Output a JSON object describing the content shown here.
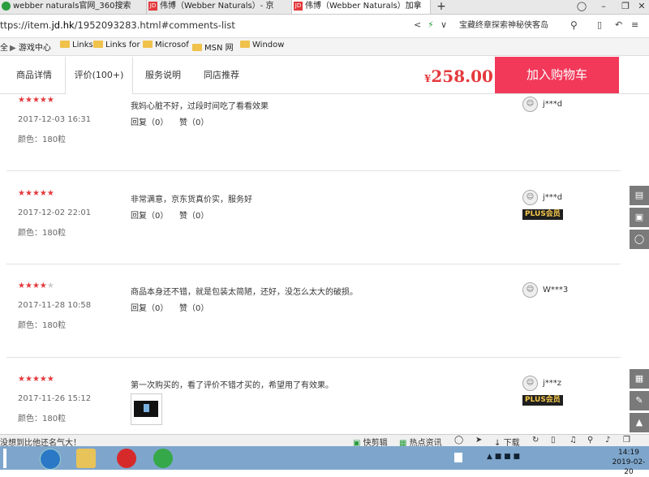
{
  "browser": {
    "tabs": [
      {
        "title": "webber naturals官网_360搜索",
        "icon": "search-favicon",
        "color": "#2a9d3f"
      },
      {
        "title": "伟博（Webber Naturals）- 京",
        "icon": "jd-favicon",
        "color": "#e4393c"
      },
      {
        "title": "伟博（Webber Naturals）加拿",
        "icon": "jd-favicon",
        "color": "#e4393c"
      }
    ],
    "new_tab": "+",
    "url_prefix": "ttps://item.",
    "url_domain": "jd.hk",
    "url_rest": "/1952093283.html#comments-list",
    "search_text": "宝藏终章探索神秘侠客岛",
    "bookmarks": [
      "全",
      "游戏中心",
      "Links",
      "Links for",
      "Microsof",
      "MSN 网",
      "Window"
    ]
  },
  "product_nav": {
    "tabs": [
      "商品详情",
      "评价(100+)",
      "服务说明",
      "同店推荐"
    ],
    "currency": "¥",
    "price": "258.00",
    "cart_button": "加入购物车"
  },
  "comments": [
    {
      "rating": 5,
      "date": "2017-12-03 16:31",
      "attr": "颜色：180粒",
      "text": "我妈心脏不好，过段时间吃了看看效果",
      "reply": "回复（0）",
      "like": "赞（0）",
      "user": "j***d",
      "plus": ""
    },
    {
      "rating": 5,
      "date": "2017-12-02 22:01",
      "attr": "颜色：180粒",
      "text": "非常满意，京东货真价实，服务好",
      "reply": "回复（0）",
      "like": "赞（0）",
      "user": "j***d",
      "plus": "PLUS会员"
    },
    {
      "rating": 4,
      "date": "2017-11-28 10:58",
      "attr": "颜色：180粒",
      "text": "商品本身还不错，就是包装太简陋，还好，没怎么太大的破损。",
      "reply": "回复（0）",
      "like": "赞（0）",
      "user": "W***3",
      "plus": ""
    },
    {
      "rating": 5,
      "date": "2017-11-26 15:12",
      "attr": "颜色：180粒",
      "text": "第一次购买的，看了评价不错才买的，希望用了有效果。",
      "reply": "",
      "like": "",
      "user": "j***z",
      "plus": "PLUS会员"
    }
  ],
  "statusbar": {
    "left_text": "没想到比他还名气大！",
    "items": [
      "快剪辑",
      "热点资讯",
      "下载"
    ]
  },
  "taskbar": {
    "time": "14:19",
    "date": "2019-02-20"
  }
}
